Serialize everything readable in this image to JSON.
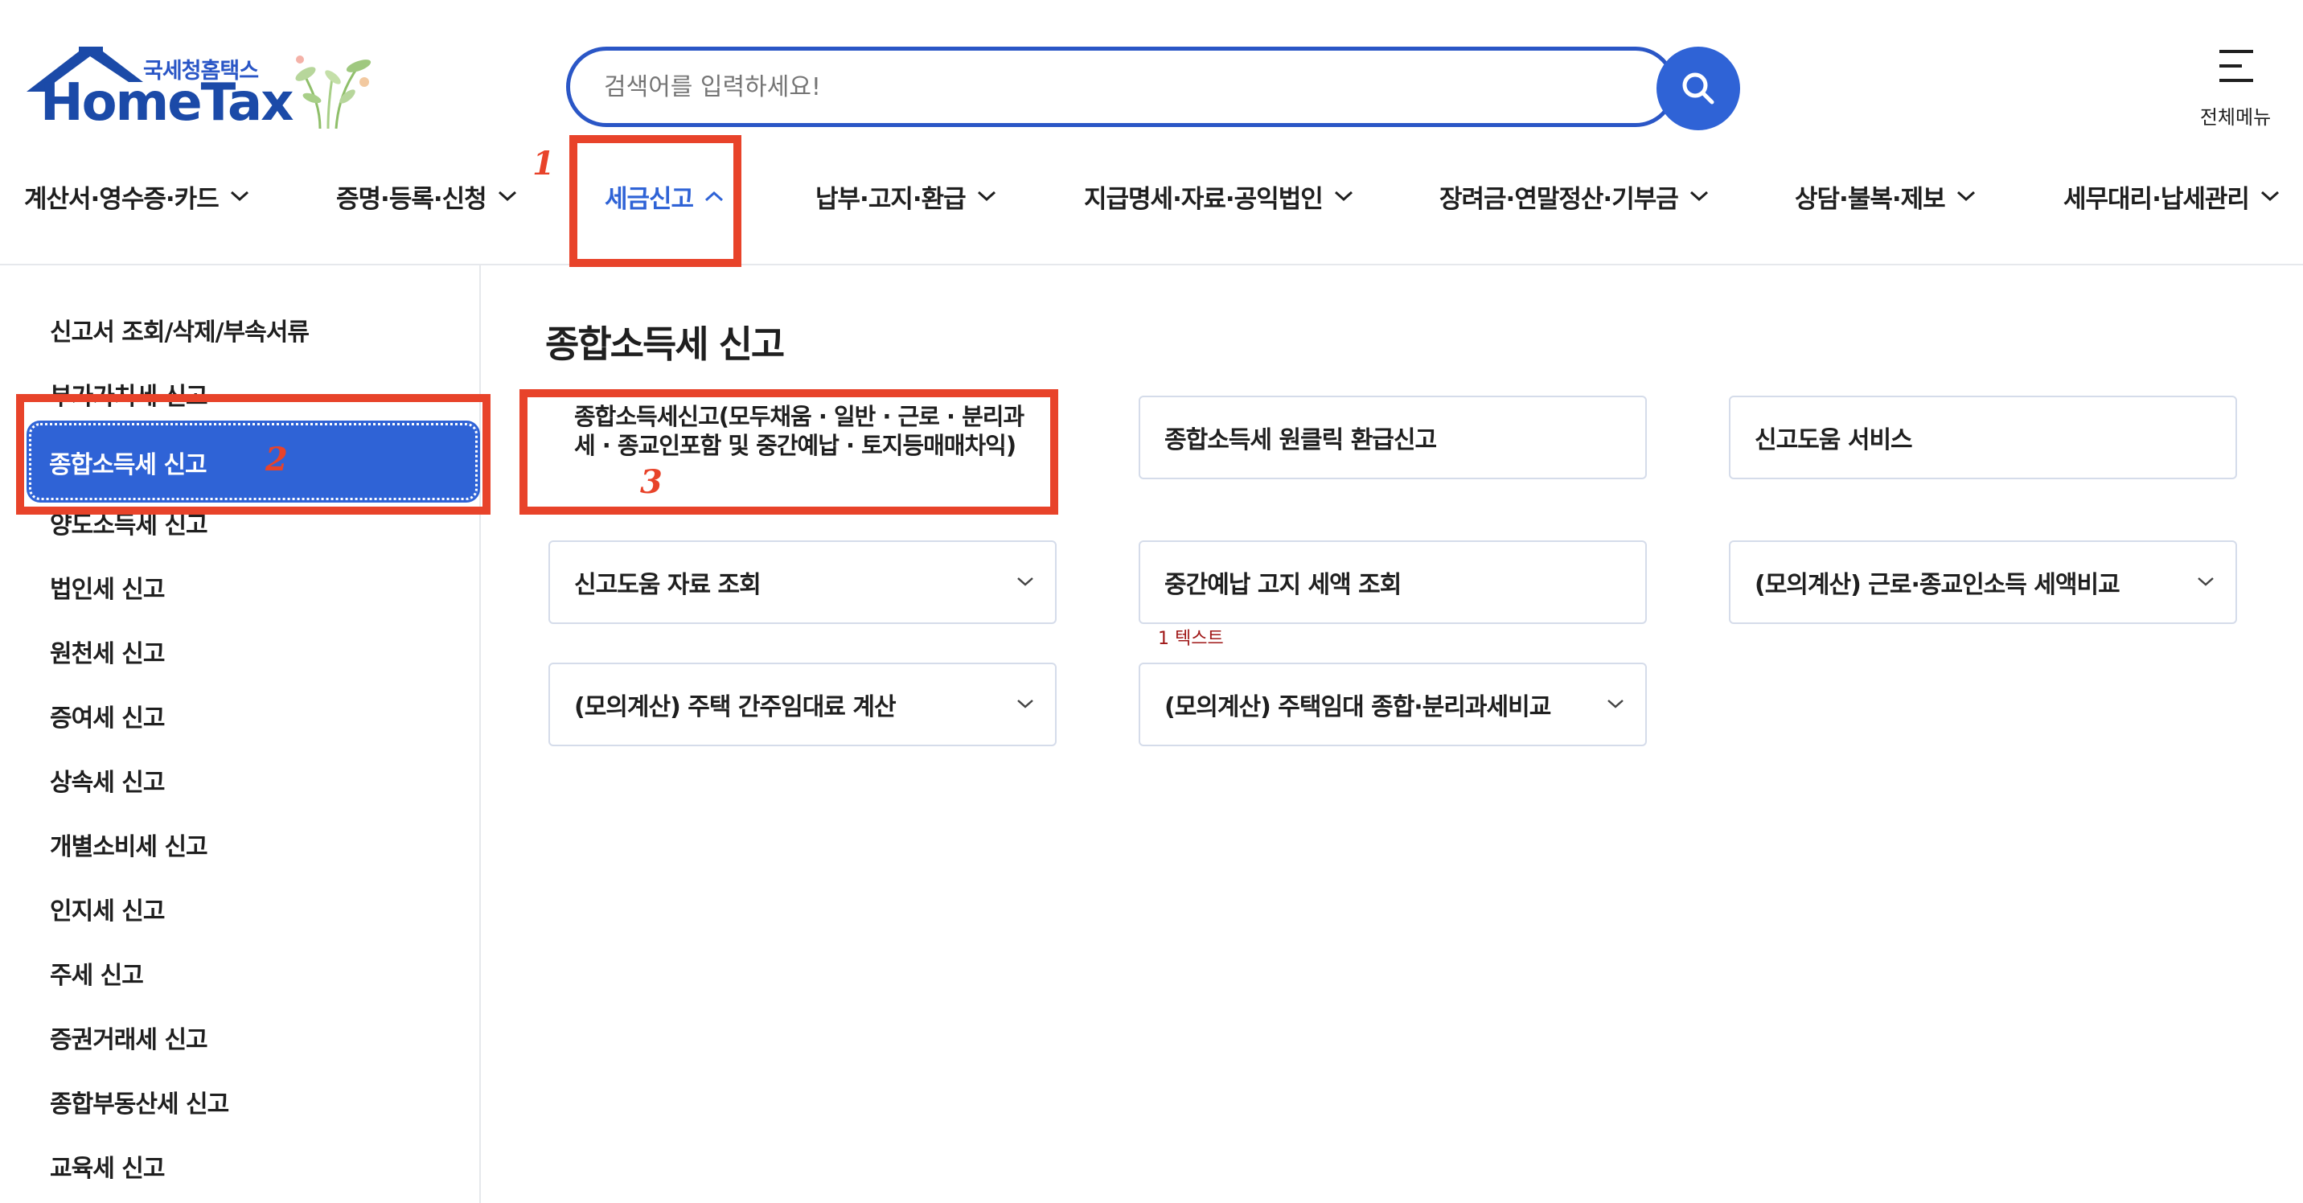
{
  "header": {
    "logo_ko": "국세청홈택스",
    "logo_en": "HomeTax",
    "search_placeholder": "검색어를 입력하세요!",
    "all_menu_label": "전체메뉴"
  },
  "gnb": [
    {
      "label": "계산서·영수증·카드",
      "active": false
    },
    {
      "label": "증명·등록·신청",
      "active": false
    },
    {
      "label": "세금신고",
      "active": true
    },
    {
      "label": "납부·고지·환급",
      "active": false
    },
    {
      "label": "지급명세·자료·공익법인",
      "active": false
    },
    {
      "label": "장려금·연말정산·기부금",
      "active": false
    },
    {
      "label": "상담·불복·제보",
      "active": false
    },
    {
      "label": "세무대리·납세관리",
      "active": false
    }
  ],
  "sidebar": {
    "items": [
      "신고서 조회/삭제/부속서류",
      "부가가치세 신고",
      "종합소득세 신고",
      "양도소득세 신고",
      "법인세 신고",
      "원천세 신고",
      "증여세 신고",
      "상속세 신고",
      "개별소비세 신고",
      "인지세 신고",
      "주세 신고",
      "증권거래세 신고",
      "종합부동산세 신고",
      "교육세 신고"
    ],
    "active_index": 2
  },
  "main": {
    "title": "종합소득세 신고",
    "cards": [
      {
        "label": "종합소득세신고(모두채움 · 일반 · 근로 · 분리과세 · 종교인포함 및 중간예납 · 토지등매매차익)",
        "has_dropdown": false
      },
      {
        "label": "종합소득세 원클릭 환급신고",
        "has_dropdown": false
      },
      {
        "label": "신고도움 서비스",
        "has_dropdown": false
      },
      {
        "label": "신고도움 자료 조회",
        "has_dropdown": true
      },
      {
        "label": "중간예납 고지 세액 조회",
        "has_dropdown": false
      },
      {
        "label": "(모의계산) 근로·종교인소득 세액비교",
        "has_dropdown": true
      },
      {
        "label": "(모의계산) 주택 간주임대료 계산",
        "has_dropdown": true
      },
      {
        "label": "(모의계산) 주택임대 종합·분리과세비교",
        "has_dropdown": true
      }
    ]
  },
  "annotations": {
    "num1": "1",
    "num2": "2",
    "num3": "3",
    "small_note": "1 텍스트",
    "color": "#e8432a"
  },
  "colors": {
    "accent": "#2f63d6",
    "brand": "#1b4aa8"
  }
}
